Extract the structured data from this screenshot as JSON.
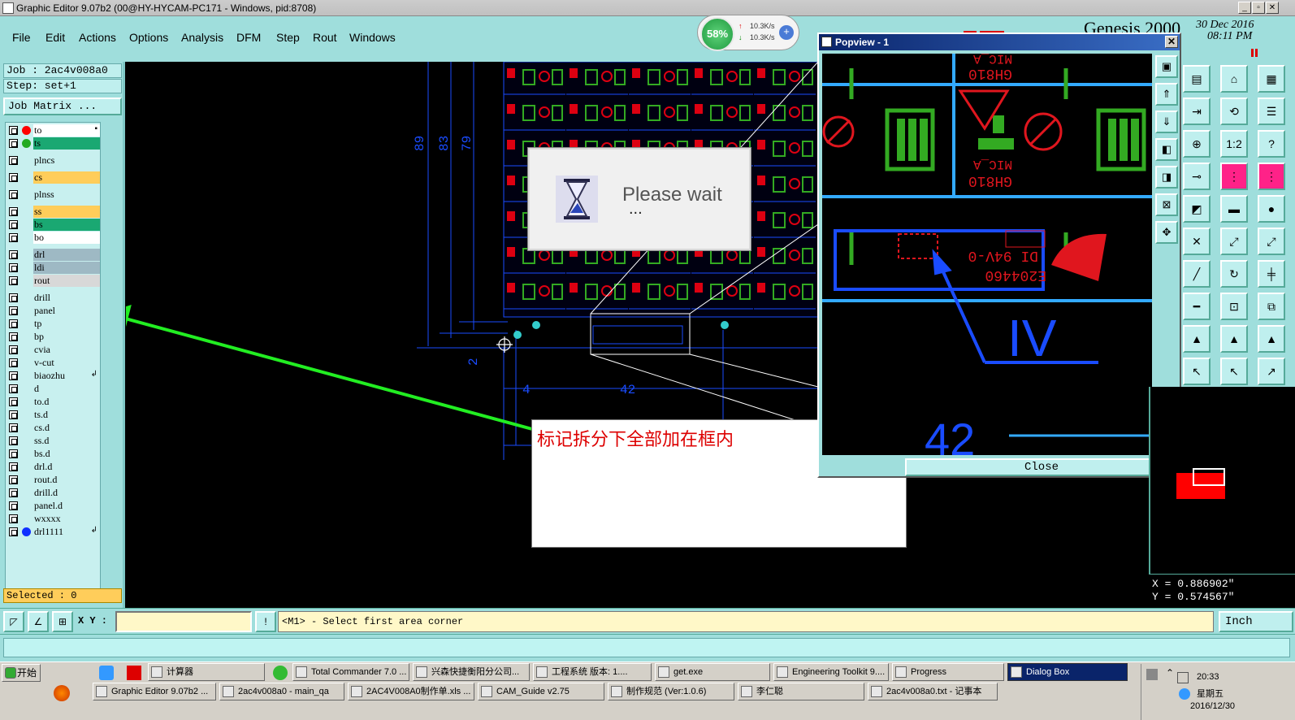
{
  "window": {
    "title": "Graphic Editor 9.07b2 (00@HY-HYCAM-PC171 - Windows, pid:8708)"
  },
  "menu": [
    "File",
    "Edit",
    "Actions",
    "Options",
    "Analysis",
    "DFM",
    "Step",
    "Rout",
    "Windows"
  ],
  "speed_widget": {
    "percent": "58%",
    "up": "10.3K/s",
    "down": "10.3K/s"
  },
  "job": {
    "job_label": "Job : 2ac4v008a0",
    "step_label": "Step: set+1",
    "matrix_button": "Job Matrix ..."
  },
  "layers": [
    {
      "name": "to",
      "color": "#ffffff",
      "dot": "#ff0000",
      "flag": "▪"
    },
    {
      "name": "ts",
      "color": "#1aa872",
      "dot": "#22aa22"
    },
    {
      "name": "plncs",
      "color": "#c8f0ef",
      "gap": true
    },
    {
      "name": "cs",
      "color": "#ffcd5a",
      "gap": true
    },
    {
      "name": "plnss",
      "color": "#c8f0ef",
      "gap": true
    },
    {
      "name": "ss",
      "color": "#ffcd5a",
      "gap": true
    },
    {
      "name": "bs",
      "color": "#1aa872"
    },
    {
      "name": "bo",
      "color": "#ffffff"
    },
    {
      "name": "drl",
      "color": "#9eb9c4",
      "gap": true
    },
    {
      "name": "ldi",
      "color": "#9eb9c4"
    },
    {
      "name": "rout",
      "color": "#d8d8d8"
    },
    {
      "name": "drill",
      "color": "#c8f0ef",
      "gap": true
    },
    {
      "name": "panel",
      "color": "#c8f0ef"
    },
    {
      "name": "tp",
      "color": "#c8f0ef"
    },
    {
      "name": "bp",
      "color": "#c8f0ef"
    },
    {
      "name": "cvia",
      "color": "#c8f0ef"
    },
    {
      "name": "v-cut",
      "color": "#c8f0ef"
    },
    {
      "name": "biaozhu",
      "color": "#c8f0ef",
      "flag": "↲"
    },
    {
      "name": "d",
      "color": "#c8f0ef"
    },
    {
      "name": "to.d",
      "color": "#c8f0ef"
    },
    {
      "name": "ts.d",
      "color": "#c8f0ef"
    },
    {
      "name": "cs.d",
      "color": "#c8f0ef"
    },
    {
      "name": "ss.d",
      "color": "#c8f0ef"
    },
    {
      "name": "bs.d",
      "color": "#c8f0ef"
    },
    {
      "name": "drl.d",
      "color": "#c8f0ef"
    },
    {
      "name": "rout.d",
      "color": "#c8f0ef"
    },
    {
      "name": "drill.d",
      "color": "#c8f0ef"
    },
    {
      "name": "panel.d",
      "color": "#c8f0ef"
    },
    {
      "name": "wxxxx",
      "color": "#c8f0ef"
    },
    {
      "name": "drl1111",
      "color": "#c8f0ef",
      "dot": "#1030ff",
      "flag": "↲"
    }
  ],
  "selected_label": "Selected : 0",
  "canvas": {
    "dim_labels": [
      "89",
      "83",
      "79",
      "2",
      "4",
      "42",
      "4"
    ],
    "wait_dialog": {
      "text": "Please wait",
      "dots": "..."
    },
    "note_text": "标记拆分下全部加在框内"
  },
  "popview": {
    "title": "Popview - 1",
    "close_label": "Close",
    "labels": [
      "GH810",
      "MIC_A",
      "GH810",
      "MIC_A",
      "DI 94V-0",
      "E204460",
      "IV",
      "42"
    ]
  },
  "genesis": {
    "title": "Genesis 2000",
    "date": "30 Dec 2016",
    "time": "08:11 PM"
  },
  "coords": {
    "x": "X = 0.886902\"",
    "y": "Y = 0.574567\""
  },
  "command": {
    "xy_label": "X Y :",
    "prompt": "<M1> - Select first area corner",
    "unit": "Inch"
  },
  "taskbar": {
    "start": "开始",
    "row1": [
      "计算器",
      "Total Commander 7.0 ...",
      "兴森快捷衡阳分公司...",
      "工程系统  版本: 1....",
      "get.exe",
      "Engineering Toolkit 9....",
      "Progress",
      "Dialog Box"
    ],
    "row2": [
      "Graphic Editor 9.07b2 ...",
      "2ac4v008a0 - main_qa",
      "2AC4V008A0制作单.xls ...",
      "CAM_Guide v2.75",
      "制作规范 (Ver:1.0.6)",
      "李仁聪",
      "2ac4v008a0.txt - 记事本"
    ],
    "clock": {
      "time": "20:33",
      "day": "星期五",
      "date": "2016/12/30"
    }
  }
}
